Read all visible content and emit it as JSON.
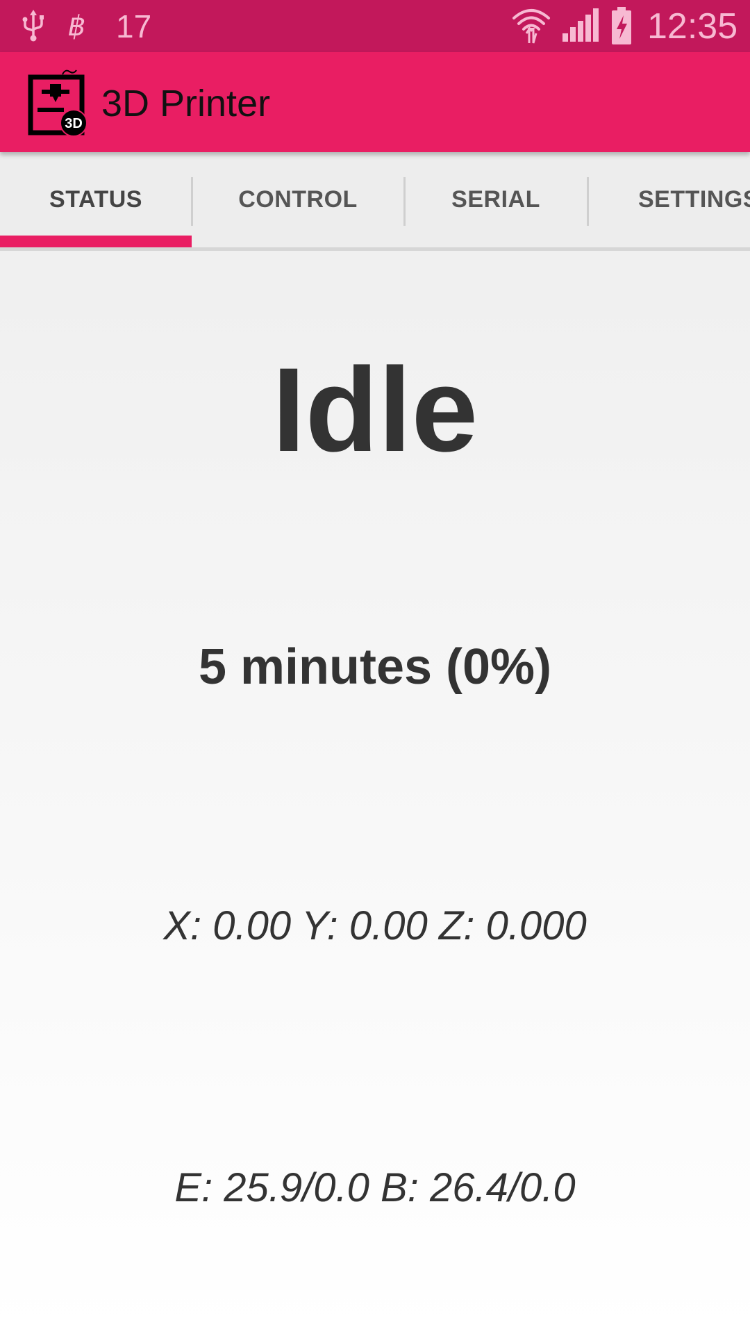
{
  "status_bar": {
    "left_icons": [
      "usb-icon",
      "bitcoin-icon"
    ],
    "notification_count": "17",
    "right_icons": [
      "wifi-icon",
      "cell-signal-icon",
      "battery-charging-icon"
    ],
    "time": "12:35"
  },
  "app_bar": {
    "logo_icon": "3d-printer-icon",
    "title": "3D Printer",
    "color": "#e91e63"
  },
  "tabs": [
    {
      "label": "STATUS",
      "selected": true
    },
    {
      "label": "CONTROL",
      "selected": false
    },
    {
      "label": "SERIAL",
      "selected": false
    },
    {
      "label": "SETTINGS",
      "selected": false
    }
  ],
  "status": {
    "state": "Idle",
    "progress": "5 minutes (0%)",
    "position": "X: 0.00 Y: 0.00 Z: 0.000",
    "temperatures": "E: 25.9/0.0 B: 26.4/0.0"
  },
  "colors": {
    "accent": "#e91e63",
    "status_bar": "#c2185b",
    "text": "#333333"
  }
}
